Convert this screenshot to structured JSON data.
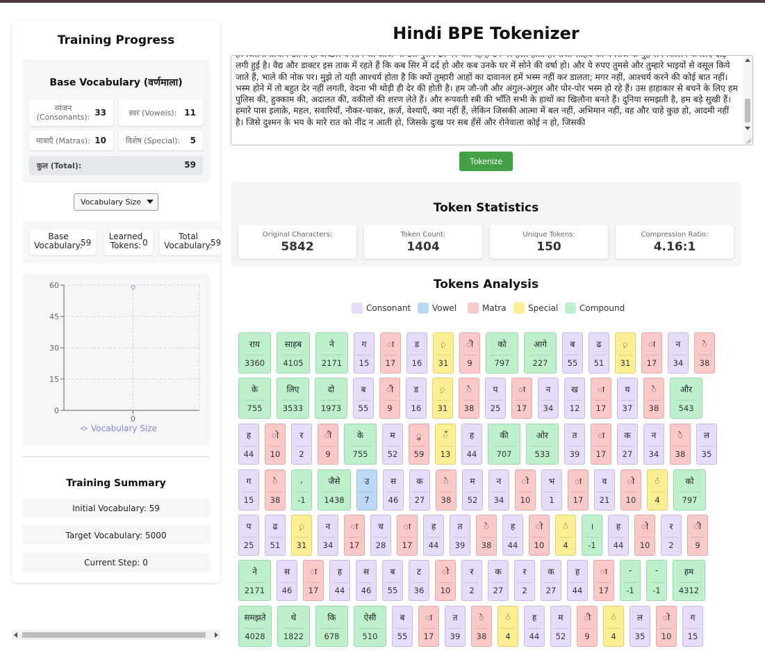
{
  "sidebar": {
    "title": "Training Progress",
    "base_vocab": {
      "title": "Base Vocabulary (वर्णमाला)",
      "consonants": {
        "label": "व्यंजन (Consonants):",
        "value": "33"
      },
      "vowels": {
        "label": "स्वर (Vowels):",
        "value": "11"
      },
      "matras": {
        "label": "मात्राएँ (Matras):",
        "value": "10"
      },
      "special": {
        "label": "विशेष (Special):",
        "value": "5"
      },
      "total": {
        "label": "कुल (Total):",
        "value": "59"
      }
    },
    "select": {
      "value": "Vocabulary Size"
    },
    "stats": {
      "base": {
        "label": "Base Vocabulary:",
        "value": "59"
      },
      "learned": {
        "label": "Learned Tokens:",
        "value": "0"
      },
      "total": {
        "label": "Total Vocabulary:",
        "value": "59"
      }
    },
    "summary": {
      "title": "Training Summary",
      "initial": "Initial Vocabulary: 59",
      "target": "Target Vocabulary: 5000",
      "step": "Current Step: 0"
    }
  },
  "chart_data": {
    "type": "line",
    "series": [
      {
        "name": "Vocabulary Size",
        "values": [
          59
        ]
      }
    ],
    "x": [
      0
    ],
    "x_ticks": [
      "0"
    ],
    "y_ticks": [
      "0",
      "15",
      "30",
      "45",
      "60"
    ],
    "ylim": [
      0,
      60
    ],
    "grid": true,
    "legend_placement": "bottom",
    "color": "#8884d8"
  },
  "main": {
    "title": "Hindi BPE Tokenizer",
    "input_text": "हैं। जितना प्राचीन उतना ही अच्छा। वे लोग जो आज भी उस पुराने ढर्रे पर चल रहे हैं उन पर हैरत होती है। राजा साहब को यमराज के मुँह से निकालने के लिए दौड़ लगी हुई है। वैद्य और डाक्टर इस ताक में रहते हैं कि कब सिर में दर्द हो और कब उनके घर में सोने की वर्षा हो। और ये रुपए तुमसे और तुम्हारे भाइयों से वसूल किये जाते हैं, भाले की नोक पर। मुझे तो यही आश्चर्य होता है कि क्यों तुम्हारी आहों का दावानल हमें भस्म नहीं कर डालता; मगर नहीं, आश्चर्य करने की कोई बात नहीं। भस्म होने में तो बहुत देर नहीं लगती, वेदना भी थोड़ी ही देर की होती है। हम जौ-जौ और अंगुल-अंगुल और पोर-पोर भस्म हो रहे हैं। उस हाहाकार से बचने के लिए हम पुलिस की, हुक्काम की, अदालत की, वकीलों की शरण लेते हैं। और रूपवती स्त्री की भाँति सभी के हाथों का खिलौना बनते हैं। दुनिया समझती है, हम बड़े सुखी हैं। हमारे पास इलाक़े, महल, सवारियाँ, नौकर-चाकर, क़र्ज़, वेश्याएँ, क्या नहीं हैं, लेकिन जिसकी आत्मा में बल नहीं, अभिमान नहीं, वह और चाहे कुछ हो, आदमी नहीं है। जिसे दुश्मन के भय के मारे रात को नींद न आती हो, जिसके दुःख पर सब हँसें और रोनेवाला कोई न हो, जिसकी",
    "tokenize_label": "Tokenize",
    "stats": {
      "title": "Token Statistics",
      "original_chars": {
        "label": "Original Characters:",
        "value": "5842"
      },
      "token_count": {
        "label": "Token Count:",
        "value": "1404"
      },
      "unique_tokens": {
        "label": "Unique Tokens:",
        "value": "150"
      },
      "compression": {
        "label": "Compression Ratio:",
        "value": "4.16:1"
      }
    },
    "analysis": {
      "title": "Tokens Analysis",
      "legend": [
        {
          "label": "Consonant",
          "color": "#e6dcfa"
        },
        {
          "label": "Vowel",
          "color": "#bcd8f7"
        },
        {
          "label": "Matra",
          "color": "#fbc8c8"
        },
        {
          "label": "Special",
          "color": "#fcef93"
        },
        {
          "label": "Compound",
          "color": "#bff0cc"
        }
      ],
      "tokens": [
        [
          [
            "राय",
            "3360",
            "compound"
          ],
          [
            "साहब",
            "4105",
            "compound"
          ],
          [
            "ने",
            "2171",
            "compound"
          ],
          [
            "ग",
            "15",
            "consonant"
          ],
          [
            "ा",
            "17",
            "matra"
          ],
          [
            "ड",
            "16",
            "consonant"
          ],
          [
            "़",
            "31",
            "special"
          ],
          [
            "ी",
            "9",
            "matra"
          ],
          [
            "को",
            "797",
            "compound"
          ],
          [
            "आगे",
            "227",
            "compound"
          ],
          [
            "ब",
            "55",
            "consonant"
          ],
          [
            "ढ",
            "51",
            "consonant"
          ],
          [
            "़",
            "31",
            "special"
          ],
          [
            "ा",
            "17",
            "matra"
          ],
          [
            "न",
            "34",
            "consonant"
          ],
          [
            "े",
            "38",
            "matra"
          ]
        ],
        [
          [
            "के",
            "755",
            "compound"
          ],
          [
            "लिए",
            "3533",
            "compound"
          ],
          [
            "दो",
            "1973",
            "compound"
          ],
          [
            "ब",
            "55",
            "consonant"
          ],
          [
            "ी",
            "9",
            "matra"
          ],
          [
            "ड",
            "16",
            "consonant"
          ],
          [
            "़",
            "31",
            "special"
          ],
          [
            "े",
            "38",
            "matra"
          ],
          [
            "प",
            "25",
            "consonant"
          ],
          [
            "ा",
            "17",
            "matra"
          ],
          [
            "न",
            "34",
            "consonant"
          ],
          [
            "ख",
            "12",
            "consonant"
          ],
          [
            "ा",
            "17",
            "matra"
          ],
          [
            "य",
            "37",
            "consonant"
          ],
          [
            "े",
            "38",
            "matra"
          ],
          [
            "और",
            "543",
            "compound"
          ]
        ],
        [
          [
            "ह",
            "44",
            "consonant"
          ],
          [
            "ो",
            "10",
            "matra"
          ],
          [
            "र",
            "2",
            "consonant"
          ],
          [
            "ी",
            "9",
            "matra"
          ],
          [
            "के",
            "755",
            "compound"
          ],
          [
            "म",
            "52",
            "consonant"
          ],
          [
            "ु",
            "59",
            "matra"
          ],
          [
            "ँ",
            "13",
            "special"
          ],
          [
            "ह",
            "44",
            "consonant"
          ],
          [
            "की",
            "707",
            "compound"
          ],
          [
            "ओर",
            "533",
            "compound"
          ],
          [
            "त",
            "39",
            "consonant"
          ],
          [
            "ा",
            "17",
            "matra"
          ],
          [
            "क",
            "27",
            "consonant"
          ],
          [
            "न",
            "34",
            "consonant"
          ],
          [
            "े",
            "38",
            "matra"
          ],
          [
            "ल",
            "35",
            "consonant"
          ]
        ],
        [
          [
            "ग",
            "15",
            "consonant"
          ],
          [
            "े",
            "38",
            "matra"
          ],
          [
            ",",
            "-1",
            "compound"
          ],
          [
            "जैसे",
            "1438",
            "compound"
          ],
          [
            "उ",
            "7",
            "vowel"
          ],
          [
            "स",
            "46",
            "consonant"
          ],
          [
            "क",
            "27",
            "consonant"
          ],
          [
            "े",
            "38",
            "matra"
          ],
          [
            "म",
            "52",
            "consonant"
          ],
          [
            "न",
            "34",
            "consonant"
          ],
          [
            "ो",
            "10",
            "matra"
          ],
          [
            "भ",
            "1",
            "consonant"
          ],
          [
            "ा",
            "17",
            "matra"
          ],
          [
            "व",
            "21",
            "consonant"
          ],
          [
            "ो",
            "10",
            "matra"
          ],
          [
            "ं",
            "4",
            "special"
          ],
          [
            "को",
            "797",
            "compound"
          ]
        ],
        [
          [
            "प",
            "25",
            "consonant"
          ],
          [
            "ढ",
            "51",
            "consonant"
          ],
          [
            "़",
            "31",
            "special"
          ],
          [
            "न",
            "34",
            "consonant"
          ],
          [
            "ा",
            "17",
            "matra"
          ],
          [
            "च",
            "28",
            "consonant"
          ],
          [
            "ा",
            "17",
            "matra"
          ],
          [
            "ह",
            "44",
            "consonant"
          ],
          [
            "त",
            "39",
            "consonant"
          ],
          [
            "े",
            "38",
            "matra"
          ],
          [
            "ह",
            "44",
            "consonant"
          ],
          [
            "ो",
            "10",
            "matra"
          ],
          [
            "ं",
            "4",
            "special"
          ],
          [
            "।",
            "-1",
            "compound"
          ],
          [
            "ह",
            "44",
            "consonant"
          ],
          [
            "ो",
            "10",
            "matra"
          ],
          [
            "र",
            "2",
            "consonant"
          ],
          [
            "ी",
            "9",
            "matra"
          ]
        ],
        [
          [
            "ने",
            "2171",
            "compound"
          ],
          [
            "स",
            "46",
            "consonant"
          ],
          [
            "ा",
            "17",
            "matra"
          ],
          [
            "ह",
            "44",
            "consonant"
          ],
          [
            "स",
            "46",
            "consonant"
          ],
          [
            "ब",
            "55",
            "consonant"
          ],
          [
            "ट",
            "36",
            "consonant"
          ],
          [
            "ो",
            "10",
            "matra"
          ],
          [
            "र",
            "2",
            "consonant"
          ],
          [
            "क",
            "27",
            "consonant"
          ],
          [
            "र",
            "2",
            "consonant"
          ],
          [
            "क",
            "27",
            "consonant"
          ],
          [
            "ह",
            "44",
            "consonant"
          ],
          [
            "ा",
            "17",
            "matra"
          ],
          [
            "-",
            "-1",
            "compound"
          ],
          [
            "-",
            "-1",
            "compound"
          ],
          [
            "हम",
            "4312",
            "compound"
          ]
        ],
        [
          [
            "समझते",
            "4028",
            "compound"
          ],
          [
            "थे",
            "1822",
            "compound"
          ],
          [
            "कि",
            "678",
            "compound"
          ],
          [
            "ऐसी",
            "510",
            "compound"
          ],
          [
            "ब",
            "55",
            "consonant"
          ],
          [
            "ा",
            "17",
            "matra"
          ],
          [
            "त",
            "39",
            "consonant"
          ],
          [
            "े",
            "38",
            "matra"
          ],
          [
            "ं",
            "4",
            "special"
          ],
          [
            "ह",
            "44",
            "consonant"
          ],
          [
            "म",
            "52",
            "consonant"
          ],
          [
            "ी",
            "9",
            "matra"
          ],
          [
            "ं",
            "4",
            "special"
          ],
          [
            "ल",
            "35",
            "consonant"
          ],
          [
            "ो",
            "10",
            "matra"
          ],
          [
            "ग",
            "15",
            "consonant"
          ]
        ]
      ]
    }
  }
}
